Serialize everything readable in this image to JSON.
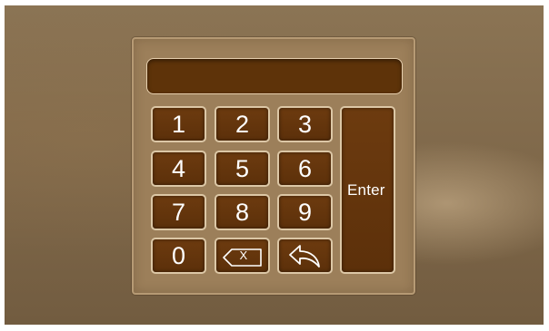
{
  "keypad": {
    "display_value": "",
    "keys": {
      "k1": "1",
      "k2": "2",
      "k3": "3",
      "k4": "4",
      "k5": "5",
      "k6": "6",
      "k7": "7",
      "k8": "8",
      "k9": "9",
      "k0": "0"
    },
    "enter_label": "Enter",
    "backspace_glyph": "X",
    "icons": {
      "backspace": "backspace-icon",
      "back": "back-arrow-icon"
    }
  },
  "colors": {
    "key_fill": "#5c300a",
    "key_border": "#dcc7a6",
    "panel": "#9c7f5a",
    "display_fill": "#5e3309"
  }
}
